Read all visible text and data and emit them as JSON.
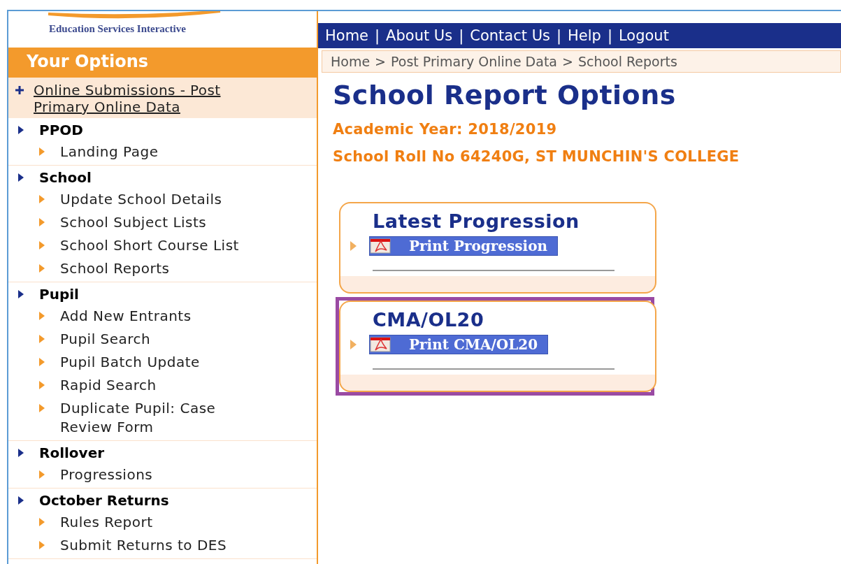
{
  "logo": {
    "text": "Education Services Interactive"
  },
  "nav": [
    "Home",
    "|",
    "About Us",
    "|",
    "Contact Us",
    "|",
    "Help",
    "|",
    "Logout"
  ],
  "sidebar": {
    "title": "Your Options",
    "top_link": {
      "label": "Online Submissions - Post Primary Online Data"
    },
    "sections": [
      {
        "label": "PPOD",
        "children": [
          {
            "label": "Landing Page"
          }
        ]
      },
      {
        "label": "School",
        "children": [
          {
            "label": "Update School Details"
          },
          {
            "label": "School Subject Lists"
          },
          {
            "label": "School Short Course List"
          },
          {
            "label": "School Reports"
          }
        ]
      },
      {
        "label": "Pupil",
        "children": [
          {
            "label": "Add New Entrants"
          },
          {
            "label": "Pupil Search"
          },
          {
            "label": "Pupil Batch Update"
          },
          {
            "label": "Rapid Search"
          },
          {
            "label": "Duplicate Pupil: Case Review Form"
          }
        ]
      },
      {
        "label": "Rollover",
        "children": [
          {
            "label": "Progressions"
          }
        ]
      },
      {
        "label": "October Returns",
        "children": [
          {
            "label": "Rules Report"
          },
          {
            "label": "Submit Returns to DES"
          }
        ]
      }
    ]
  },
  "breadcrumb": [
    "Home",
    ">",
    "Post Primary Online Data",
    ">",
    "School Reports"
  ],
  "page_title": "School Report Options",
  "academic_year": "Academic Year: 2018/2019",
  "school_roll": "School Roll No 64240G, ST MUNCHIN'S COLLEGE",
  "cards": [
    {
      "title": "Latest Progression",
      "button": "Print Progression",
      "highlighted": false
    },
    {
      "title": "CMA/OL20",
      "button": "Print CMA/OL20",
      "highlighted": true
    }
  ]
}
